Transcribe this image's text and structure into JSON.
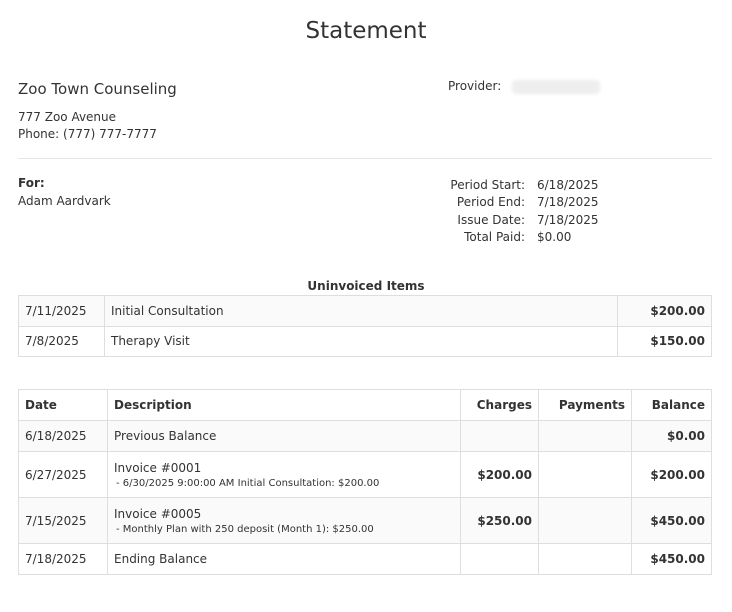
{
  "header": {
    "title": "Statement"
  },
  "practice": {
    "name": "Zoo Town Counseling",
    "address": "777 Zoo Avenue",
    "phone": "Phone: (777) 777-7777",
    "provider_label": "Provider:"
  },
  "client": {
    "for_label": "For:",
    "name": "Adam Aardvark"
  },
  "period": [
    {
      "label": "Period Start:",
      "value": "6/18/2025"
    },
    {
      "label": "Period End:",
      "value": "7/18/2025"
    },
    {
      "label": "Issue Date:",
      "value": "7/18/2025"
    },
    {
      "label": "Total Paid:",
      "value": "$0.00"
    }
  ],
  "uninvoiced": {
    "title": "Uninvoiced Items",
    "rows": [
      {
        "date": "7/11/2025",
        "description": "Initial Consultation",
        "amount": "$200.00"
      },
      {
        "date": "7/8/2025",
        "description": "Therapy Visit",
        "amount": "$150.00"
      }
    ]
  },
  "ledger": {
    "columns": {
      "date": "Date",
      "description": "Description",
      "charges": "Charges",
      "payments": "Payments",
      "balance": "Balance"
    },
    "rows": [
      {
        "date": "6/18/2025",
        "description": "Previous Balance",
        "detail": "",
        "charges": "",
        "payments": "",
        "balance": "$0.00"
      },
      {
        "date": "6/27/2025",
        "description": "Invoice #0001",
        "detail": "- 6/30/2025 9:00:00 AM Initial Consultation: $200.00",
        "charges": "$200.00",
        "payments": "",
        "balance": "$200.00"
      },
      {
        "date": "7/15/2025",
        "description": "Invoice #0005",
        "detail": "- Monthly Plan with 250 deposit (Month 1): $250.00",
        "charges": "$250.00",
        "payments": "",
        "balance": "$450.00"
      },
      {
        "date": "7/18/2025",
        "description": "Ending Balance",
        "detail": "",
        "charges": "",
        "payments": "",
        "balance": "$450.00"
      }
    ]
  }
}
